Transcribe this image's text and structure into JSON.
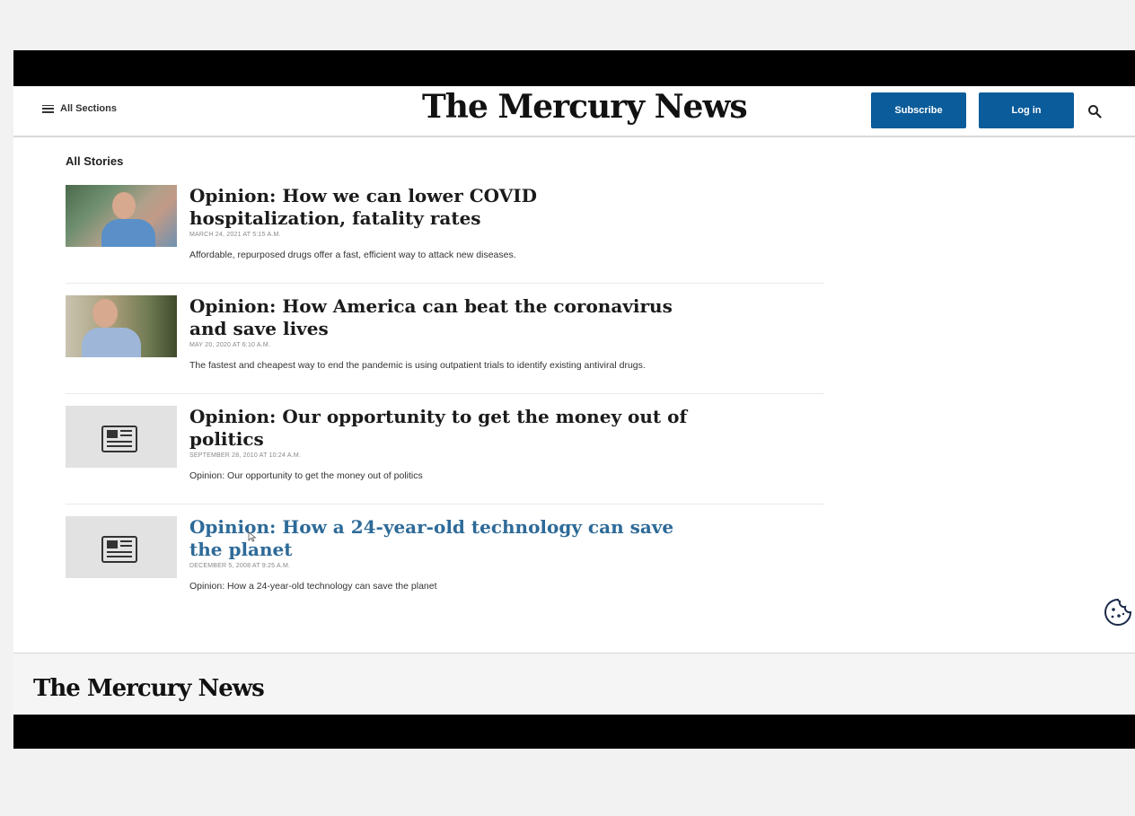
{
  "header": {
    "menu_label": "All Sections",
    "logo_text": "The Mercury News",
    "subscribe_label": "Subscribe",
    "login_label": "Log in",
    "accent_color": "#0b5c9a"
  },
  "main": {
    "section_title": "All Stories",
    "stories": [
      {
        "headline": "Opinion: How we can lower COVID hospitalization, fatality rates",
        "date": "MARCH 24, 2021 AT 5:15 A.M.",
        "summary": "Affordable, repurposed drugs offer a fast, efficient way to attack new diseases.",
        "thumbnail": "photo"
      },
      {
        "headline": "Opinion: How America can beat the coronavirus and save lives",
        "date": "MAY 20, 2020 AT 6:10 A.M.",
        "summary": "The fastest and cheapest way to end the pandemic is using outpatient trials to identify existing antiviral drugs.",
        "thumbnail": "photo"
      },
      {
        "headline": "Opinion: Our opportunity to get the money out of politics",
        "date": "SEPTEMBER 28, 2010 AT 10:24 A.M.",
        "summary": "Opinion: Our opportunity to get the money out of politics",
        "thumbnail": "newspaper-icon"
      },
      {
        "headline": "Opinion: How a 24-year-old technology can save the planet",
        "date": "DECEMBER 5, 2008 AT 9:25 A.M.",
        "summary": "Opinion: How a 24-year-old technology can save the planet",
        "thumbnail": "newspaper-icon"
      }
    ]
  },
  "footer": {
    "logo_text": "The Mercury News"
  },
  "icons": {
    "menu": "hamburger-icon",
    "search": "search-icon",
    "cookie": "cookie-icon",
    "placeholder": "newspaper-icon"
  }
}
